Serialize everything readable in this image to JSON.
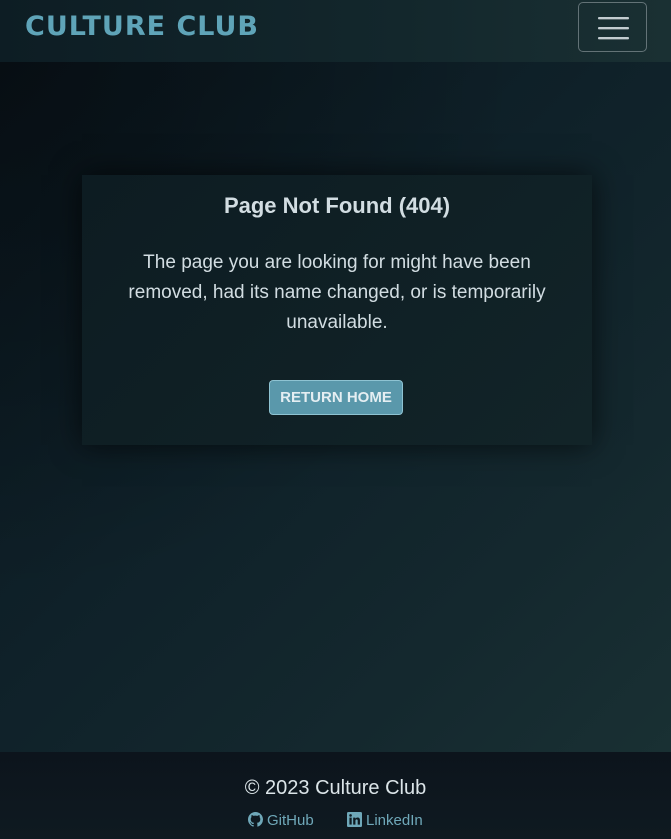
{
  "navbar": {
    "brand": "CULTURE CLUB",
    "toggle_icon": "hamburger-menu-icon"
  },
  "card": {
    "title": "Page Not Found (404)",
    "message": "The page you are looking for might have been removed, had its name changed, or is temporarily unavailable.",
    "button_label": "RETURN HOME"
  },
  "footer": {
    "copyright": "© 2023 Culture Club",
    "links": [
      {
        "label": "GitHub",
        "icon": "github-icon"
      },
      {
        "label": "LinkedIn",
        "icon": "linkedin-icon"
      }
    ]
  },
  "colors": {
    "brand": "#5fa4b8",
    "button_bg": "#5a98ab",
    "link": "#6fa8b9",
    "text": "#d2dde2"
  }
}
